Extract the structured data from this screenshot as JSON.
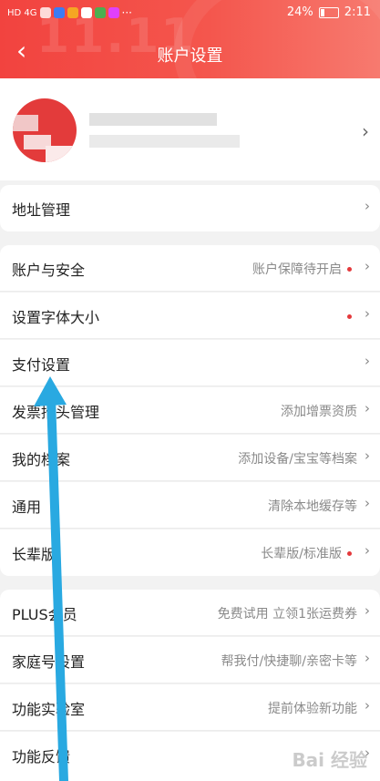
{
  "status_bar": {
    "signal": "HD 4G",
    "more": "···",
    "battery": "24%",
    "time": "2:11"
  },
  "header": {
    "deco": "11.11",
    "title": "账户设置",
    "back_icon": "back-arrow-icon"
  },
  "rows": [
    {
      "label": "地址管理",
      "value": "",
      "dot": false
    },
    {
      "label": "账户与安全",
      "value": "账户保障待开启",
      "dot": true
    },
    {
      "label": "设置字体大小",
      "value": "",
      "dot": true
    },
    {
      "label": "支付设置",
      "value": "",
      "dot": false
    },
    {
      "label": "发票抬头管理",
      "value": "添加增票资质",
      "dot": false
    },
    {
      "label": "我的档案",
      "value": "添加设备/宝宝等档案",
      "dot": false
    },
    {
      "label": "通用",
      "value": "清除本地缓存等",
      "dot": false
    },
    {
      "label": "长辈版",
      "value": "长辈版/标准版",
      "dot": true
    },
    {
      "label": "PLUS会员",
      "value": "免费试用 立领1张运费券",
      "dot": false
    },
    {
      "label": "家庭号设置",
      "value": "帮我付/快捷聊/亲密卡等",
      "dot": false
    },
    {
      "label": "功能实验室",
      "value": "提前体验新功能",
      "dot": false
    },
    {
      "label": "功能反馈",
      "value": "",
      "dot": false
    }
  ],
  "watermark": "Bai 经验",
  "colors": {
    "accent": "#e4393c",
    "header": "#f2433f",
    "arrow": "#29a9e1"
  }
}
